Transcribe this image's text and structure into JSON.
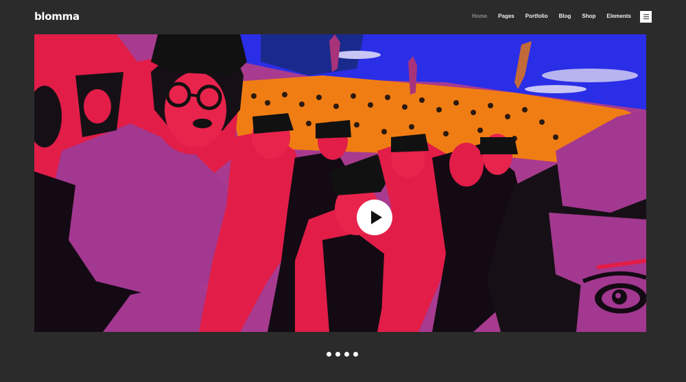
{
  "brand": {
    "logo": "blomma"
  },
  "nav": {
    "items": [
      {
        "label": "Home",
        "active": true
      },
      {
        "label": "Pages"
      },
      {
        "label": "Portfolio"
      },
      {
        "label": "Blog"
      },
      {
        "label": "Shop"
      },
      {
        "label": "Elements"
      }
    ],
    "menu_icon": "hamburger-icon"
  },
  "hero": {
    "media": "video",
    "play_icon": "play-icon"
  },
  "slider": {
    "slide_count": 4,
    "active_index": 0
  },
  "colors": {
    "page_background": "#2b2b2b",
    "active_nav": "#8c8c8c",
    "nav_text": "#f2f2f2"
  }
}
